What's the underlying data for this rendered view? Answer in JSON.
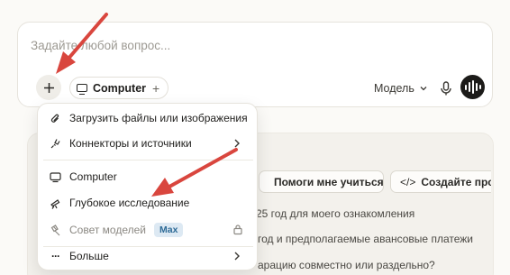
{
  "composer": {
    "placeholder": "Задайте любой вопрос...",
    "chip_label": "Computer",
    "model_label": "Модель"
  },
  "menu": {
    "items": [
      {
        "label": "Загрузить файлы или изображения",
        "icon": "paperclip-icon"
      },
      {
        "label": "Коннекторы и источники",
        "icon": "plug-icon",
        "submenu": true
      },
      {
        "label": "Computer",
        "icon": "monitor-icon"
      },
      {
        "label": "Глубокое исследование",
        "icon": "telescope-icon"
      },
      {
        "label": "Совет моделей",
        "icon": "gavel-icon",
        "badge": "Max",
        "locked": true,
        "muted": true
      },
      {
        "label": "Больше",
        "icon": "more-icon",
        "submenu": true
      }
    ]
  },
  "background": {
    "chips": [
      "Помоги мне учиться",
      "Создайте прото"
    ],
    "lines": [
      "25 год для моего ознакомления",
      "год и предполагаемые авансовые платежи",
      "арацию совместно или раздельно?"
    ]
  },
  "colors": {
    "annotation_arrow": "#d9463e",
    "badge_bg": "#dde9f3",
    "badge_text": "#2d6a96"
  }
}
